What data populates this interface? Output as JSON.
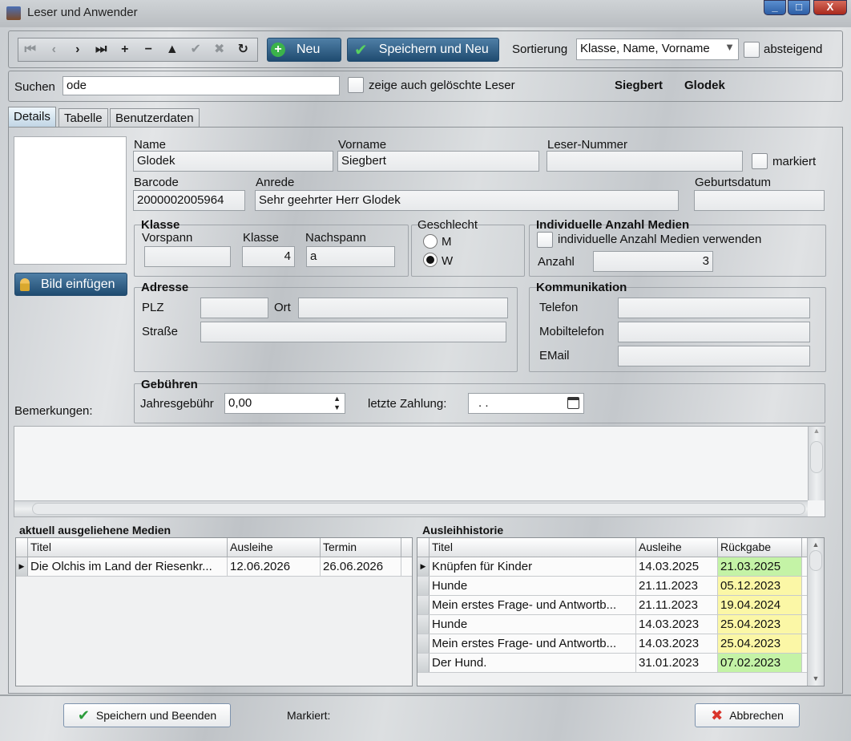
{
  "window": {
    "title": "Leser und Anwender",
    "min": "_",
    "max": "□",
    "close": "X"
  },
  "toolbar": {
    "nav": [
      "⏮",
      "‹",
      "›",
      "⏭",
      "+",
      "−",
      "▲",
      "✔",
      "✖",
      "↻"
    ],
    "new_label": "Neu",
    "save_new_label": "Speichern und Neu",
    "sort_label": "Sortierung",
    "sort_value": "Klasse, Name, Vorname",
    "desc_label": "absteigend"
  },
  "search": {
    "label": "Suchen",
    "value": "ode",
    "show_deleted_label": "zeige auch gelöschte Leser",
    "first_name": "Siegbert",
    "last_name": "Glodek"
  },
  "tabs": [
    "Details",
    "Tabelle",
    "Benutzerdaten"
  ],
  "details": {
    "insert_image_label": "Bild einfügen",
    "name_label": "Name",
    "name_value": "Glodek",
    "vorname_label": "Vorname",
    "vorname_value": "Siegbert",
    "lesernr_label": "Leser-Nummer",
    "lesernr_value": "",
    "markiert_label": "markiert",
    "barcode_label": "Barcode",
    "barcode_value": "2000002005964",
    "anrede_label": "Anrede",
    "anrede_value": "Sehr geehrter Herr Glodek",
    "geburt_label": "Geburtsdatum",
    "geburt_value": "",
    "klasse": {
      "title": "Klasse",
      "vorspann_label": "Vorspann",
      "vorspann_value": "",
      "klasse_label": "Klasse",
      "klasse_value": "4",
      "nachspann_label": "Nachspann",
      "nachspann_value": "a"
    },
    "geschlecht": {
      "title": "Geschlecht",
      "m": "M",
      "w": "W",
      "selected": "W"
    },
    "medien": {
      "title": "Individuelle Anzahl Medien",
      "use_label": "individuelle Anzahl Medien verwenden",
      "anzahl_label": "Anzahl",
      "anzahl_value": "3"
    },
    "adresse": {
      "title": "Adresse",
      "plz_label": "PLZ",
      "plz_value": "",
      "ort_label": "Ort",
      "ort_value": "",
      "strasse_label": "Straße",
      "strasse_value": ""
    },
    "kommunikation": {
      "title": "Kommunikation",
      "telefon_label": "Telefon",
      "telefon_value": "",
      "mobil_label": "Mobiltelefon",
      "mobil_value": "",
      "email_label": "EMail",
      "email_value": ""
    },
    "gebuehren": {
      "title": "Gebühren",
      "jahres_label": "Jahresgebühr",
      "jahres_value": "0,00",
      "zahlung_label": "letzte Zahlung:",
      "zahlung_value": ". ."
    },
    "bemerkungen_label": "Bemerkungen:"
  },
  "current": {
    "title": "aktuell ausgeliehene Medien",
    "columns": [
      "Titel",
      "Ausleihe",
      "Termin"
    ],
    "rows": [
      {
        "titel": "Die Olchis im Land der Riesenkr...",
        "ausleihe": "12.06.2026",
        "termin": "26.06.2026"
      }
    ]
  },
  "history": {
    "title": "Ausleihhistorie",
    "columns": [
      "Titel",
      "Ausleihe",
      "Rückgabe"
    ],
    "rows": [
      {
        "titel": "Knüpfen für Kinder",
        "ausleihe": "14.03.2025",
        "rueckgabe": "21.03.2025",
        "status": "green"
      },
      {
        "titel": "Hunde",
        "ausleihe": "21.11.2023",
        "rueckgabe": "05.12.2023",
        "status": "yellow"
      },
      {
        "titel": "Mein erstes Frage- und Antwortb...",
        "ausleihe": "21.11.2023",
        "rueckgabe": "19.04.2024",
        "status": "yellow"
      },
      {
        "titel": "Hunde",
        "ausleihe": "14.03.2023",
        "rueckgabe": "25.04.2023",
        "status": "yellow"
      },
      {
        "titel": "Mein erstes Frage- und Antwortb...",
        "ausleihe": "14.03.2023",
        "rueckgabe": "25.04.2023",
        "status": "yellow"
      },
      {
        "titel": "Der Hund.",
        "ausleihe": "31.01.2023",
        "rueckgabe": "07.02.2023",
        "status": "green"
      }
    ]
  },
  "footer": {
    "save_close_label": "Speichern und Beenden",
    "markiert_label": "Markiert:",
    "cancel_label": "Abbrechen"
  },
  "colors": {
    "green": "#c4f3a6",
    "yellow": "#fbf7a6",
    "accent": "#1f4b70"
  }
}
